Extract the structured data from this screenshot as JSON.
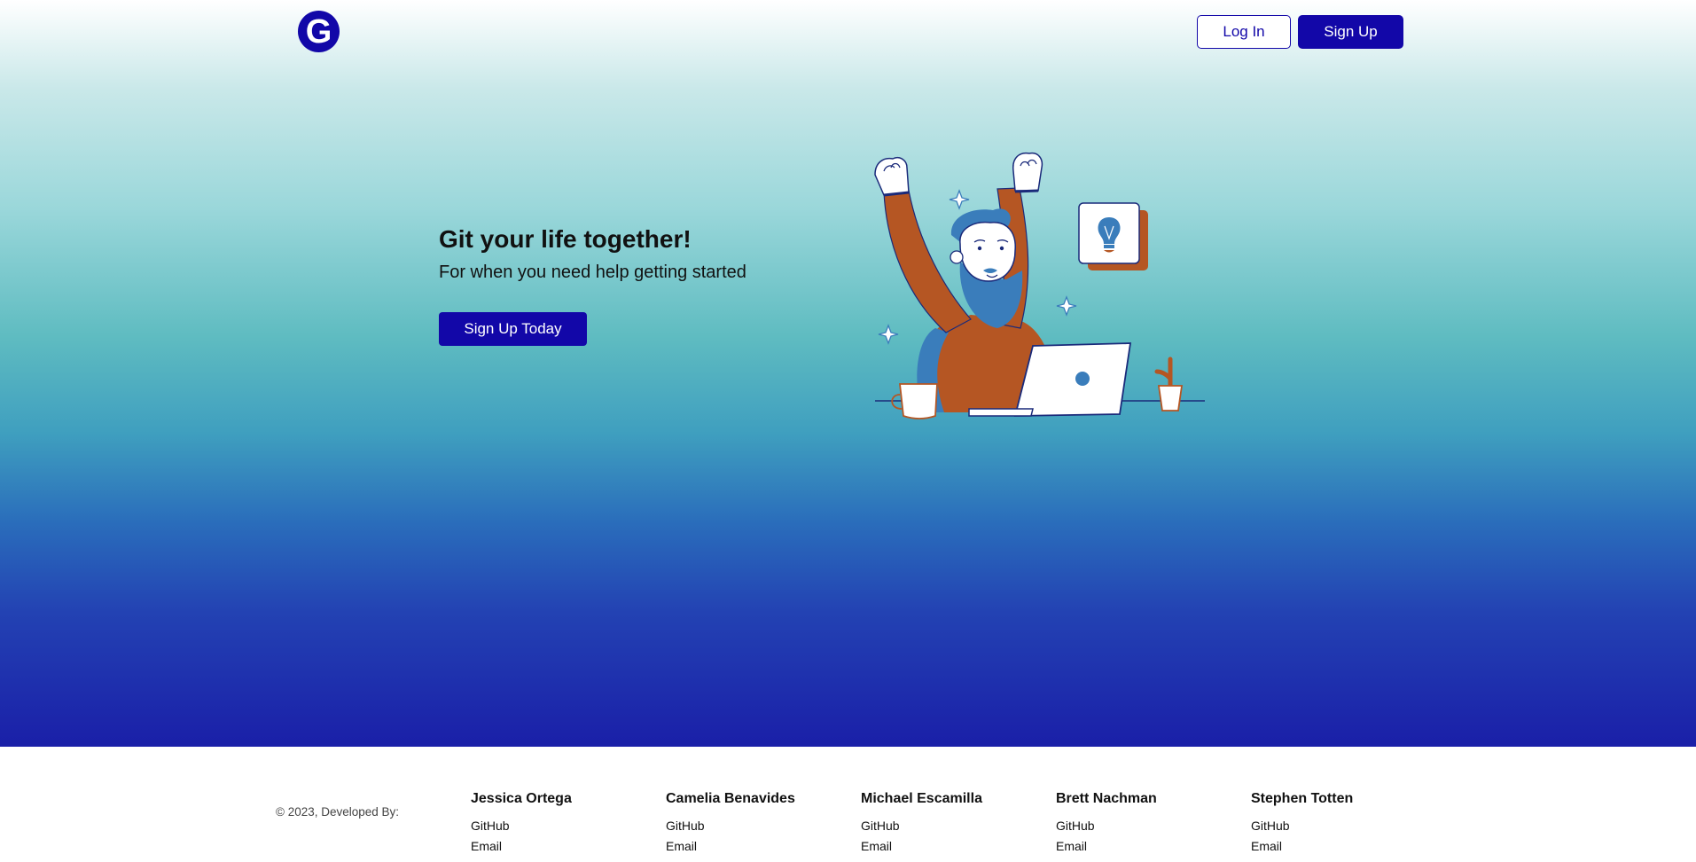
{
  "header": {
    "logo_letter": "G",
    "login_label": "Log In",
    "signup_label": "Sign Up"
  },
  "hero": {
    "title": "Git your life together!",
    "subtitle": "For when you need help getting started",
    "cta_label": "Sign Up Today"
  },
  "illustration": {
    "icon": "celebrating-person-laptop-illustration",
    "colors": {
      "orange": "#b55623",
      "blue": "#3a7dbb",
      "navy": "#1a2a7a",
      "white": "#ffffff"
    }
  },
  "footer": {
    "copyright": "© 2023, Developed By:",
    "developers": [
      {
        "name": "Jessica Ortega",
        "github": "GitHub",
        "email": "Email"
      },
      {
        "name": "Camelia Benavides",
        "github": "GitHub",
        "email": "Email"
      },
      {
        "name": "Michael Escamilla",
        "github": "GitHub",
        "email": "Email"
      },
      {
        "name": "Brett Nachman",
        "github": "GitHub",
        "email": "Email"
      },
      {
        "name": "Stephen Totten",
        "github": "GitHub",
        "email": "Email"
      }
    ]
  },
  "colors": {
    "brand": "#1207a8",
    "gradient_top": "#ffffff",
    "gradient_mid": "#5fbcc1",
    "gradient_bottom": "#1a1fa8"
  }
}
